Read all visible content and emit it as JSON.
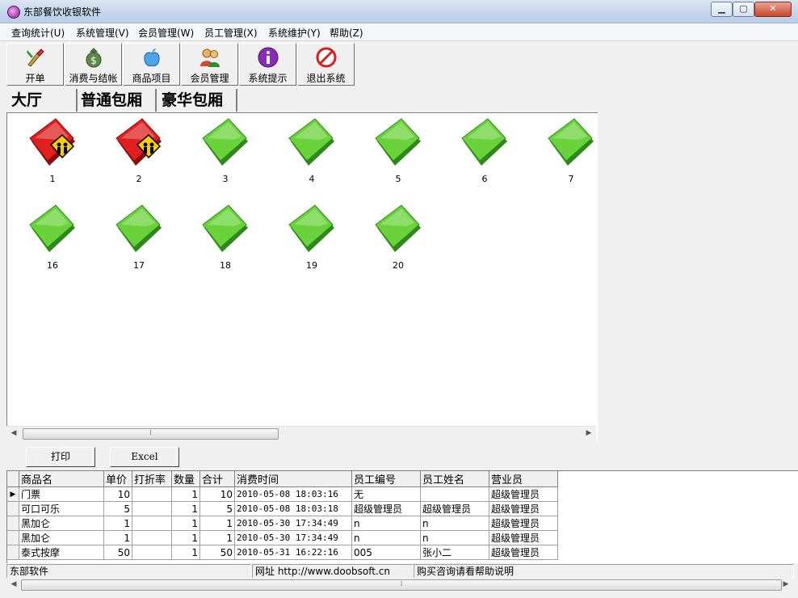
{
  "window": {
    "title": "东部餐饮收银软件"
  },
  "menu": [
    "查询统计(U)",
    "系统管理(V)",
    "会员管理(W)",
    "员工管理(X)",
    "系统维护(Y)",
    "帮助(Z)"
  ],
  "toolbar": [
    {
      "label": "开单",
      "icon": "brush-icon"
    },
    {
      "label": "消费与结帐",
      "icon": "money-bag-icon"
    },
    {
      "label": "商品项目",
      "icon": "apple-icon"
    },
    {
      "label": "会员管理",
      "icon": "people-icon"
    },
    {
      "label": "系统提示",
      "icon": "info-icon"
    },
    {
      "label": "退出系统",
      "icon": "stop-icon"
    }
  ],
  "room_tabs": [
    "大厅",
    "普通包厢",
    "豪华包厢"
  ],
  "rooms": [
    {
      "number": "1",
      "status": "occupied"
    },
    {
      "number": "2",
      "status": "occupied"
    },
    {
      "number": "3",
      "status": "free"
    },
    {
      "number": "4",
      "status": "free"
    },
    {
      "number": "5",
      "status": "free"
    },
    {
      "number": "6",
      "status": "free"
    },
    {
      "number": "7",
      "status": "free"
    },
    {
      "number": "16",
      "status": "free"
    },
    {
      "number": "17",
      "status": "free"
    },
    {
      "number": "18",
      "status": "free"
    },
    {
      "number": "19",
      "status": "free"
    },
    {
      "number": "20",
      "status": "free"
    }
  ],
  "actions": {
    "print": "打印",
    "excel": "Excel"
  },
  "grid": {
    "columns": [
      "商品名",
      "单价",
      "打折率",
      "数量",
      "合计",
      "消费时间",
      "员工编号",
      "员工姓名",
      "营业员"
    ],
    "rows": [
      [
        "门票",
        "10",
        "",
        "1",
        "10",
        "2010-05-08 18:03:16",
        "无",
        "",
        "超级管理员"
      ],
      [
        "可口可乐",
        "5",
        "",
        "1",
        "5",
        "2010-05-08 18:03:18",
        "超级管理员",
        "超级管理员",
        "超级管理员"
      ],
      [
        "黑加仑",
        "1",
        "",
        "1",
        "1",
        "2010-05-30 17:34:49",
        "n",
        "n",
        "超级管理员"
      ],
      [
        "黑加仑",
        "1",
        "",
        "1",
        "1",
        "2010-05-30 17:34:49",
        "n",
        "n",
        "超级管理员"
      ],
      [
        "泰式按摩",
        "50",
        "",
        "1",
        "50",
        "2010-05-31 16:22:16",
        "005",
        "张小二",
        "超级管理员"
      ]
    ]
  },
  "status": [
    "东部软件",
    "网址 http://www.doobsoft.cn",
    "购买咨询请看帮助说明"
  ],
  "colors": {
    "occupied": "#e02020",
    "free": "#6ad23a"
  }
}
